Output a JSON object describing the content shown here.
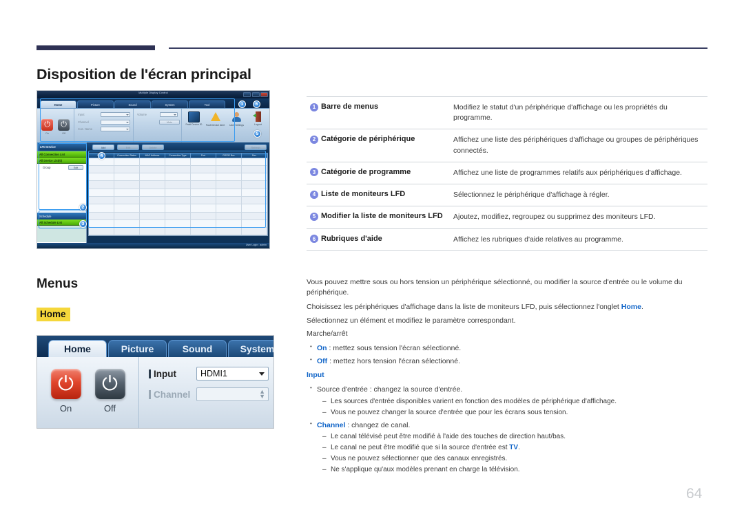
{
  "page": {
    "title": "Disposition de l'écran principal",
    "number": "64"
  },
  "section": {
    "menus_heading": "Menus",
    "home_heading": "Home"
  },
  "app_screenshot": {
    "window_title": "Multiple Display Control",
    "tabs": [
      "Home",
      "Picture",
      "Sound",
      "System",
      "Tool"
    ],
    "power": {
      "on": "On",
      "off": "Off"
    },
    "fields": [
      {
        "label": "Input"
      },
      {
        "label": "Channel"
      },
      {
        "label": "Cus. Name"
      }
    ],
    "volume_label": "Volume",
    "mute_label": "Mute",
    "toolbar_icons": [
      {
        "name": "fault-device-id-icon",
        "label": "Fault Device ID"
      },
      {
        "name": "fault-device-alert-icon",
        "label": "Fault Device Alert"
      },
      {
        "name": "user-settings-icon",
        "label": "User Settings"
      },
      {
        "name": "logout-icon",
        "label": "Logout"
      }
    ],
    "device_panel": {
      "header": "LFD Device",
      "all_connection_list": "All Connection List",
      "all_device_list": "All Device List(0)",
      "group_label": "Group",
      "edit_button": "Edit"
    },
    "schedule_panel": {
      "header": "Schedule",
      "all_schedule_list": "All Schedule List"
    },
    "sub_buttons": {
      "add": "Add",
      "edit": "Edit",
      "delete": "Delete",
      "refresh": "Refresh"
    },
    "grid_headers": [
      "Settings",
      "Connection Status",
      "MAC Address",
      "Connection Type",
      "Port",
      "RS232 Box",
      "Dev"
    ],
    "status_bar": "User Login : admin",
    "callouts": [
      "1",
      "2",
      "3",
      "4",
      "5",
      "6"
    ]
  },
  "home_panel_screenshot": {
    "tabs": [
      "Home",
      "Picture",
      "Sound",
      "System"
    ],
    "power_on": "On",
    "power_off": "Off",
    "input_label": "Input",
    "input_value": "HDMI1",
    "channel_label": "Channel",
    "channel_value": ""
  },
  "legend_table": {
    "rows": [
      {
        "num": "1",
        "label": "Barre de menus",
        "desc": "Modifiez le statut d'un périphérique d'affichage ou les propriétés du programme."
      },
      {
        "num": "2",
        "label": "Catégorie de périphérique",
        "desc": "Affichez une liste des périphériques d'affichage ou groupes de périphériques connectés."
      },
      {
        "num": "3",
        "label": "Catégorie de programme",
        "desc": "Affichez une liste de programmes relatifs aux périphériques d'affichage."
      },
      {
        "num": "4",
        "label": "Liste de moniteurs LFD",
        "desc": "Sélectionnez le périphérique d'affichage à régler."
      },
      {
        "num": "5",
        "label": "Modifier la liste de moniteurs LFD",
        "desc": "Ajoutez, modifiez, regroupez ou supprimez des moniteurs LFD."
      },
      {
        "num": "6",
        "label": "Rubriques d'aide",
        "desc": "Affichez les rubriques d'aide relatives au programme."
      }
    ]
  },
  "body": {
    "p1": "Vous pouvez mettre sous ou hors tension un périphérique sélectionné, ou modifier la source d'entrée ou le volume du périphérique.",
    "p2_before": "Choisissez les périphériques d'affichage dans la liste de moniteurs LFD, puis sélectionnez l'onglet ",
    "p2_link": "Home",
    "p2_after": ".",
    "p3": "Sélectionnez un élément et modifiez le paramètre correspondant.",
    "p4": "Marche/arrêt",
    "bullet_on_key": "On",
    "bullet_on_rest": " : mettez sous tension l'écran sélectionné.",
    "bullet_off_key": "Off",
    "bullet_off_rest": " : mettez hors tension l'écran sélectionné.",
    "input_heading": "Input",
    "bullet_source": "Source d'entrée : changez la source d'entrée.",
    "dash_1": "Les sources d'entrée disponibles varient en fonction des modèles de périphérique d'affichage.",
    "dash_2": "Vous ne pouvez changer la source d'entrée que pour les écrans sous tension.",
    "bullet_channel_key": "Channel",
    "bullet_channel_rest": " : changez de canal.",
    "dash_3": "Le canal télévisé peut être modifié à l'aide des touches de direction haut/bas.",
    "dash_4_before": "Le canal ne peut être modifié que si la source d'entrée est ",
    "dash_4_link": "TV",
    "dash_4_after": ".",
    "dash_5": "Vous ne pouvez sélectionner que des canaux enregistrés.",
    "dash_6": "Ne s'applique qu'aux modèles prenant en charge la télévision."
  },
  "colors": {
    "accent_blue": "#1165c8",
    "badge_blue": "#7b87e0",
    "highlight_yellow": "#f5d73b",
    "header_navy": "#2e3154"
  }
}
